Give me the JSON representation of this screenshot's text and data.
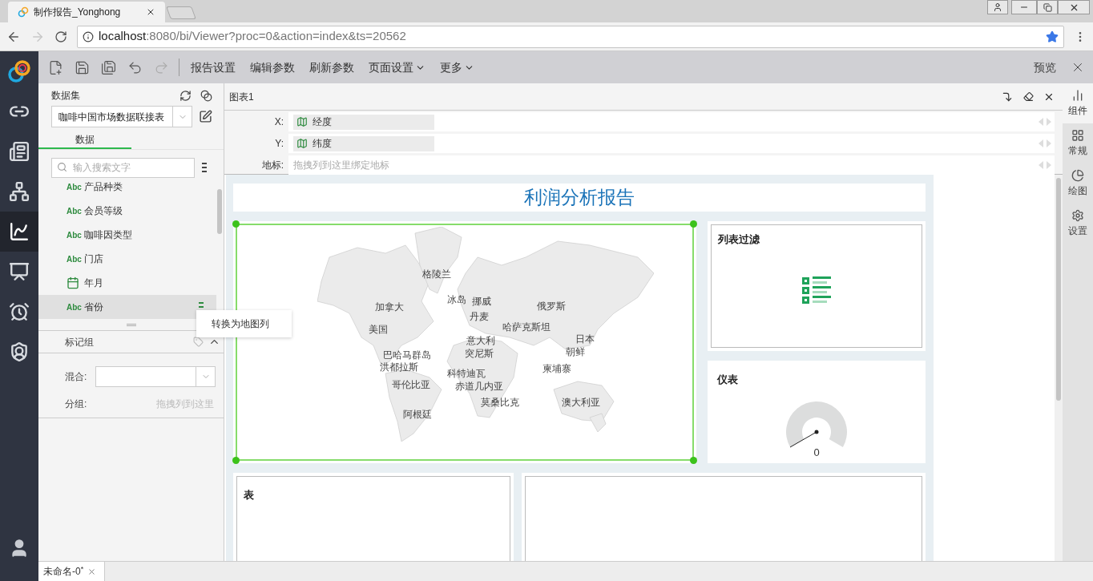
{
  "browser": {
    "tab_title": "制作报告_Yonghong",
    "url_host": "localhost",
    "url_path": ":8080/bi/Viewer?proc=0&action=index&ts=20562",
    "forward_disabled": true,
    "bookmarked": true
  },
  "rail": {
    "items": [
      {
        "kind": "link",
        "selected": false
      },
      {
        "kind": "card",
        "selected": false
      },
      {
        "kind": "network",
        "selected": false
      },
      {
        "kind": "chart",
        "selected": true
      },
      {
        "kind": "screen",
        "selected": false
      },
      {
        "kind": "alarm",
        "selected": false
      },
      {
        "kind": "shield",
        "selected": false
      }
    ]
  },
  "toolbar": {
    "icon_buttons": [
      {
        "kind": "new",
        "disabled": false
      },
      {
        "kind": "save",
        "disabled": false
      },
      {
        "kind": "save_as",
        "disabled": false
      },
      {
        "kind": "undo",
        "disabled": false
      },
      {
        "kind": "redo",
        "disabled": true
      }
    ],
    "menus": [
      {
        "label": "报告设置",
        "dropdown": false
      },
      {
        "label": "编辑参数",
        "dropdown": false
      },
      {
        "label": "刷新参数",
        "dropdown": false
      },
      {
        "label": "页面设置",
        "dropdown": true
      },
      {
        "label": "更多",
        "dropdown": true
      }
    ],
    "preview": "预览"
  },
  "data_panel": {
    "title": "数据集",
    "dataset": "咖啡中国市场数据联接表",
    "tabs": [
      {
        "label": "数据",
        "selected": true
      }
    ],
    "search": {
      "placeholder": "输入搜索文字"
    },
    "fields": [
      {
        "kind": "text",
        "type_label": "Abc",
        "name": "产品种类",
        "selected": false
      },
      {
        "kind": "text",
        "type_label": "Abc",
        "name": "会员等级",
        "selected": false
      },
      {
        "kind": "text",
        "type_label": "Abc",
        "name": "咖啡因类型",
        "selected": false
      },
      {
        "kind": "text",
        "type_label": "Abc",
        "name": "门店",
        "selected": false
      },
      {
        "kind": "date",
        "name": "年月",
        "selected": false
      },
      {
        "kind": "text",
        "type_label": "Abc",
        "name": "省份",
        "selected": true
      }
    ],
    "context_menu": [
      "转换为地图列"
    ]
  },
  "marks": {
    "title": "标记组",
    "expanded": true,
    "mix_label": "混合:",
    "group_label": "分组:",
    "group_placeholder": "拖拽列到这里"
  },
  "chart_editor": {
    "title": "图表1",
    "bindings": [
      {
        "label": "X:",
        "field": "经度"
      },
      {
        "label": "Y:",
        "field": "纬度"
      },
      {
        "label": "地标:",
        "placeholder": "拖拽列到这里绑定地标"
      }
    ]
  },
  "report": {
    "title": "利润分析报告",
    "map": {
      "selected": true,
      "labels": [
        "格陵兰",
        "加拿大",
        "冰岛",
        "挪威",
        "俄罗斯",
        "丹麦",
        "美国",
        "哈萨克斯坦",
        "意大利",
        "日本",
        "巴哈马群岛",
        "突尼斯",
        "朝鲜",
        "洪都拉斯",
        "科特迪瓦",
        "柬埔寨",
        "哥伦比亚",
        "赤道几内亚",
        "莫桑比克",
        "澳大利亚",
        "阿根廷"
      ]
    },
    "components": [
      {
        "kind": "list_filter",
        "title": "列表过滤"
      },
      {
        "kind": "gauge",
        "title": "仪表",
        "value": "0"
      },
      {
        "kind": "table",
        "title": "表"
      },
      {
        "kind": "empty"
      }
    ]
  },
  "right_panel": {
    "items": [
      {
        "kind": "components",
        "label": "组件",
        "selected": true
      },
      {
        "kind": "general",
        "label": "常规",
        "selected": false
      },
      {
        "kind": "draw",
        "label": "绘图",
        "selected": false
      },
      {
        "kind": "settings",
        "label": "设置",
        "selected": false
      }
    ]
  },
  "doc_tabs": [
    {
      "label": "未命名-0$^{*}$",
      "selected": true
    }
  ]
}
